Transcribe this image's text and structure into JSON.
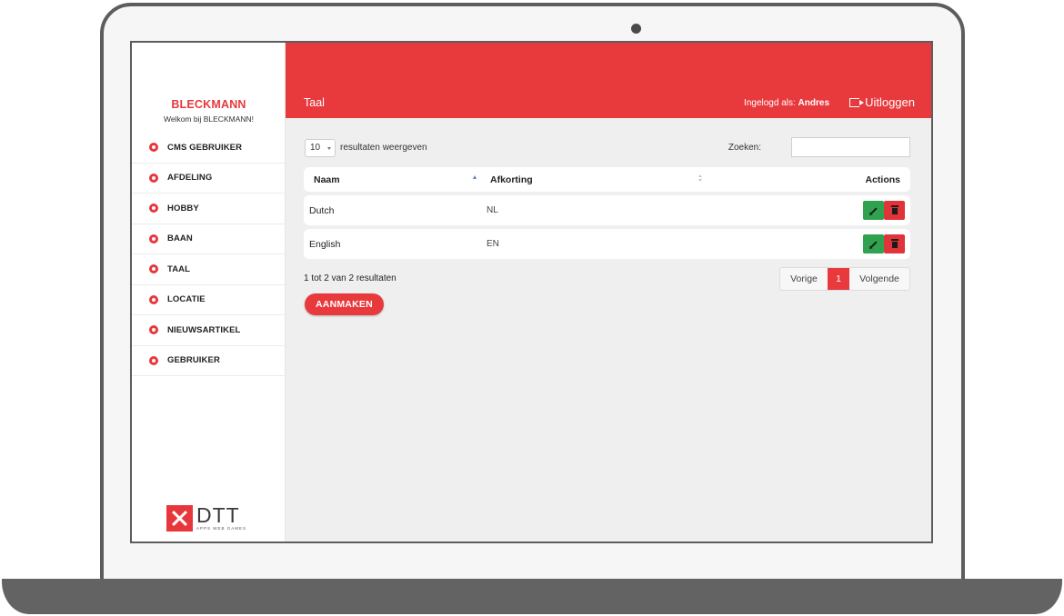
{
  "sidebar": {
    "brand": "BLECKMANN",
    "welcome": "Welkom bij BLECKMANN!",
    "items": [
      {
        "label": "CMS GEBRUIKER"
      },
      {
        "label": "AFDELING"
      },
      {
        "label": "HOBBY"
      },
      {
        "label": "BAAN"
      },
      {
        "label": "TAAL"
      },
      {
        "label": "LOCATIE"
      },
      {
        "label": "NIEUWSARTIKEL"
      },
      {
        "label": "GEBRUIKER"
      }
    ],
    "logo": {
      "word": "DTT",
      "tagline": "APPS WEB GAMES"
    }
  },
  "header": {
    "title": "Taal",
    "logged_in_prefix": "Ingelogd als:",
    "user": "Andres",
    "logout_label": "Uitloggen"
  },
  "toolbar": {
    "page_length": "10",
    "page_length_label": "resultaten weergeven",
    "search_label": "Zoeken:",
    "search_value": ""
  },
  "table": {
    "columns": [
      "Naam",
      "Afkorting",
      "Actions"
    ],
    "rows": [
      {
        "naam": "Dutch",
        "afkorting": "NL"
      },
      {
        "naam": "English",
        "afkorting": "EN"
      }
    ]
  },
  "footer": {
    "info": "1 tot 2 van 2 resultaten",
    "prev": "Vorige",
    "current_page": "1",
    "next": "Volgende",
    "create_label": "AANMAKEN"
  },
  "colors": {
    "accent": "#e8393d",
    "edit": "#2ea24f",
    "delete": "#e0343b"
  }
}
